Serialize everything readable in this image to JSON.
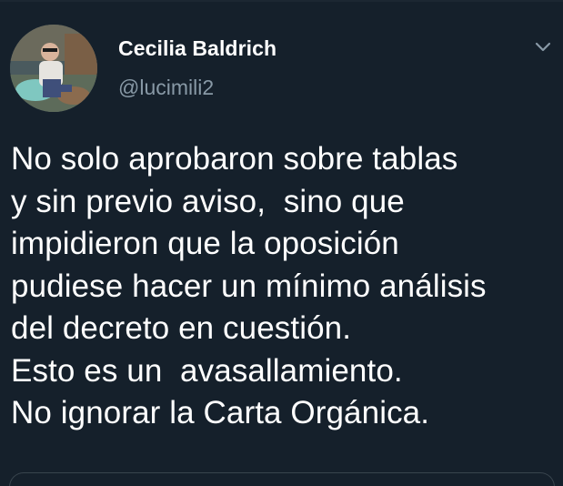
{
  "tweet": {
    "display_name": "Cecilia Baldrich",
    "handle": "@lucimili2",
    "text_lines": [
      "No solo aprobaron sobre tablas",
      "y sin previo aviso,  sino que",
      "impidieron que la oposición",
      "pudiese hacer un mínimo análisis",
      "del decreto en cuestión.",
      "Esto es un  avasallamiento.",
      "No ignorar la Carta Orgánica."
    ]
  },
  "icons": {
    "avatar": "profile-photo",
    "menu": "chevron-down-icon"
  },
  "colors": {
    "background": "#15202b",
    "text_primary": "#ffffff",
    "text_secondary": "#8899a6",
    "border": "#38444d"
  }
}
